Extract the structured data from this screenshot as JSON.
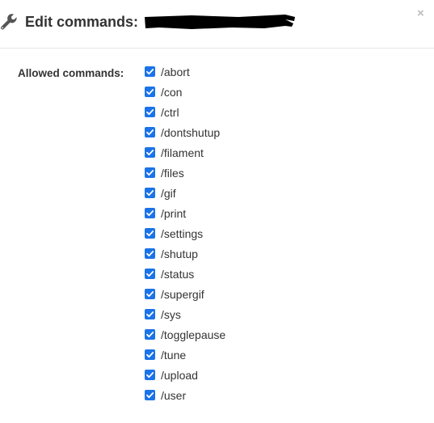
{
  "dialog": {
    "title": "Edit commands:",
    "icons": {
      "header": "wrench-icon",
      "close": "close-icon",
      "checkbox": "checkmark-icon"
    },
    "close_label": "×"
  },
  "form": {
    "allowed_label": "Allowed commands:",
    "commands": [
      {
        "label": "/abort",
        "checked": true
      },
      {
        "label": "/con",
        "checked": true
      },
      {
        "label": "/ctrl",
        "checked": true
      },
      {
        "label": "/dontshutup",
        "checked": true
      },
      {
        "label": "/filament",
        "checked": true
      },
      {
        "label": "/files",
        "checked": true
      },
      {
        "label": "/gif",
        "checked": true
      },
      {
        "label": "/print",
        "checked": true
      },
      {
        "label": "/settings",
        "checked": true
      },
      {
        "label": "/shutup",
        "checked": true
      },
      {
        "label": "/status",
        "checked": true
      },
      {
        "label": "/supergif",
        "checked": true
      },
      {
        "label": "/sys",
        "checked": true
      },
      {
        "label": "/togglepause",
        "checked": true
      },
      {
        "label": "/tune",
        "checked": true
      },
      {
        "label": "/upload",
        "checked": true
      },
      {
        "label": "/user",
        "checked": true
      }
    ]
  },
  "colors": {
    "checkbox_accent": "#1a73e8",
    "text": "#333333",
    "divider": "#e5e5e5",
    "close": "#bcbcbc"
  }
}
